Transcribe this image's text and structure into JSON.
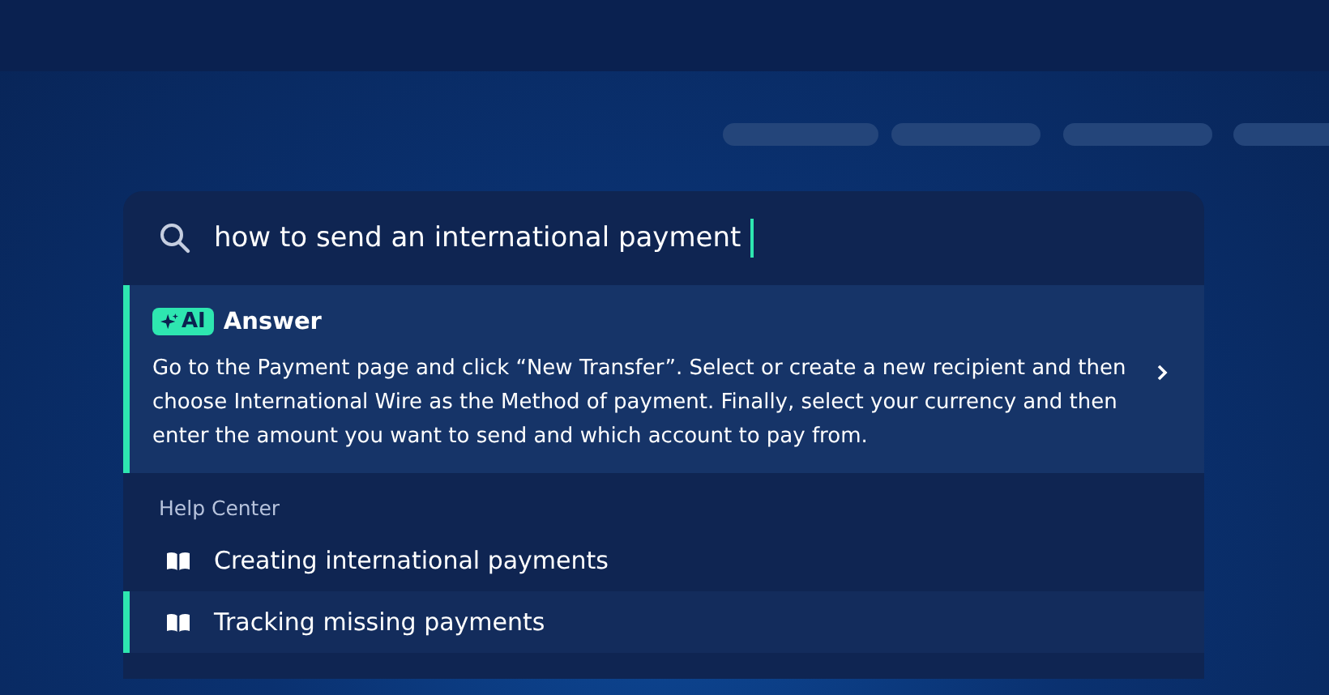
{
  "search": {
    "value": "how to send an international payment"
  },
  "answer": {
    "badge": "AI",
    "title": "Answer",
    "text": "Go to the Payment page and click “New Transfer”. Select or create a new recipient and then choose International Wire as the Method of payment. Finally, select your currency and then enter the amount you want to send and which account to pay from."
  },
  "help_center": {
    "heading": "Help Center",
    "items": [
      {
        "label": "Creating international payments",
        "selected": false
      },
      {
        "label": "Tracking missing payments",
        "selected": true
      }
    ]
  }
}
